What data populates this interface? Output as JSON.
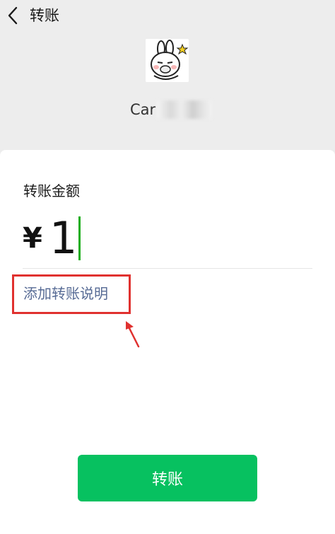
{
  "header": {
    "title": "转账",
    "back_icon": "chevron-left-icon"
  },
  "recipient": {
    "name_visible": "Car",
    "avatar_icon": "bunny-avatar"
  },
  "amount": {
    "label": "转账金额",
    "currency_symbol": "¥",
    "value": "1"
  },
  "note": {
    "add_label": "添加转账说明"
  },
  "actions": {
    "transfer_label": "转账"
  },
  "colors": {
    "background": "#ededed",
    "card": "#ffffff",
    "link": "#576b95",
    "primary_button": "#07c160",
    "caret": "#1aad19",
    "annotation": "#e0312f"
  }
}
